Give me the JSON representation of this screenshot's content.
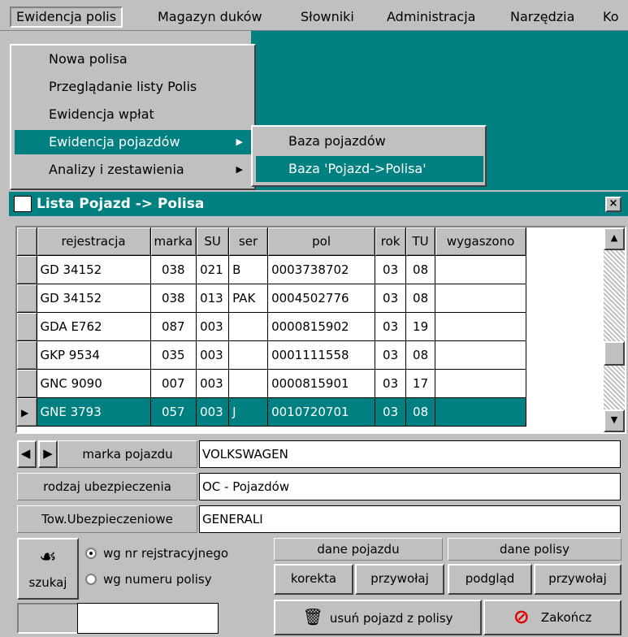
{
  "menubar": {
    "items": [
      "Ewidencja polis",
      "Magazyn duków",
      "Słowniki",
      "Administracja",
      "Narzędzia",
      "Ko"
    ]
  },
  "dropdown": {
    "items": [
      "Nowa polisa",
      "Przeglądanie listy Polis",
      "Ewidencja wpłat",
      "Ewidencja pojazdów",
      "Analizy i zestawienia"
    ]
  },
  "submenu": {
    "items": [
      "Baza pojazdów",
      "Baza 'Pojazd->Polisa'"
    ]
  },
  "window": {
    "title": "Lista Pojazd -> Polisa",
    "close_label": "×"
  },
  "grid": {
    "columns": [
      "rejestracja",
      "marka",
      "SU",
      "ser",
      "pol",
      "rok",
      "TU",
      "wygaszono"
    ],
    "rows": [
      [
        "GD 34152",
        "038",
        "021",
        "B",
        "0003738702",
        "03",
        "08",
        ""
      ],
      [
        "GD 34152",
        "038",
        "013",
        "PAK",
        "0004502776",
        "03",
        "08",
        ""
      ],
      [
        "GDA E762",
        "087",
        "003",
        "",
        "0000815902",
        "03",
        "19",
        ""
      ],
      [
        "GKP 9534",
        "035",
        "003",
        "",
        "0001111558",
        "03",
        "08",
        ""
      ],
      [
        "GNC 9090",
        "007",
        "003",
        "",
        "0000815901",
        "03",
        "17",
        ""
      ],
      [
        "GNE 3793",
        "057",
        "003",
        "J",
        "0010720701",
        "03",
        "08",
        ""
      ]
    ],
    "selected_row": 5
  },
  "details": {
    "marka_label": "marka pojazdu",
    "marka_value": "VOLKSWAGEN",
    "rodzaj_label": "rodzaj ubezpieczenia",
    "rodzaj_value": "OC - Pojazdów",
    "tow_label": "Tow.Ubezpieczeniowe",
    "tow_value": "GENERALI"
  },
  "search": {
    "button_label": "szukaj",
    "radio1": "wg nr rejstracyjnego",
    "radio2": "wg numeru polisy",
    "input_value": ""
  },
  "actions": {
    "dane_pojazdu": "dane pojazdu",
    "dane_polisy": "dane polisy",
    "korekta": "korekta",
    "przywolaj1": "przywołaj",
    "podglad": "podgląd",
    "przywolaj2": "przywołaj",
    "usun": "usuń pojazd z polisy",
    "zakoncz": "Zakończ"
  },
  "colors": {
    "accent": "#008080",
    "face": "#c0c0c0"
  }
}
